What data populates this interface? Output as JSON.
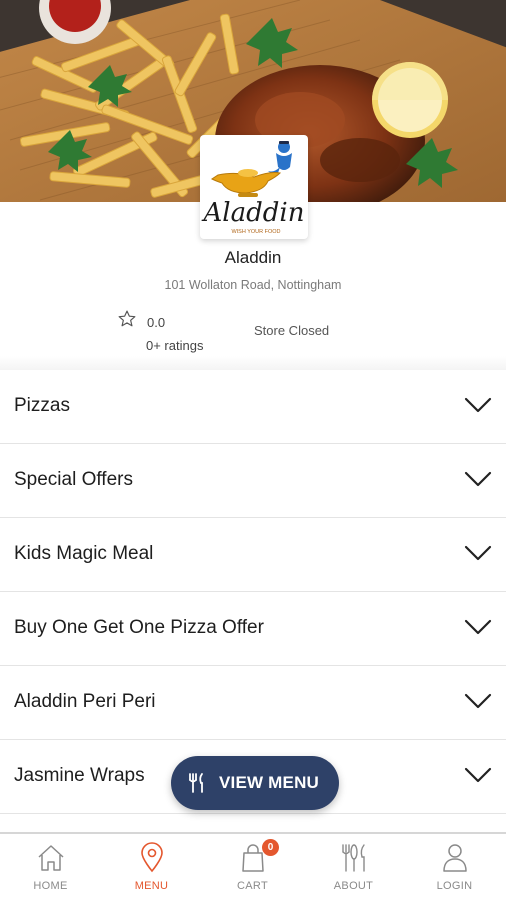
{
  "store": {
    "logo_text": "Aladdin",
    "logo_tagline": "WISH YOUR FOOD",
    "name": "Aladdin",
    "address": "101 Wollaton Road, Nottingham",
    "rating": "0.0",
    "rating_count": "0+ ratings",
    "status": "Store Closed"
  },
  "categories": [
    {
      "label": "Pizzas"
    },
    {
      "label": "Special Offers"
    },
    {
      "label": "Kids Magic Meal"
    },
    {
      "label": "Buy One Get One Pizza Offer"
    },
    {
      "label": "Aladdin Peri Peri"
    },
    {
      "label": "Jasmine Wraps"
    }
  ],
  "view_menu": {
    "label": "VIEW MENU",
    "icon": "fork-knife-icon"
  },
  "nav": {
    "home": {
      "label": "HOME",
      "icon": "home-icon"
    },
    "menu": {
      "label": "MENU",
      "icon": "location-pin-icon"
    },
    "cart": {
      "label": "CART",
      "icon": "shopping-bag-icon",
      "badge": "0"
    },
    "about": {
      "label": "ABOUT",
      "icon": "cutlery-icon"
    },
    "login": {
      "label": "LOGIN",
      "icon": "user-icon"
    }
  },
  "colors": {
    "accent": "#e4572e",
    "button": "#2e4168",
    "nav_inactive": "#8a8a8a"
  }
}
